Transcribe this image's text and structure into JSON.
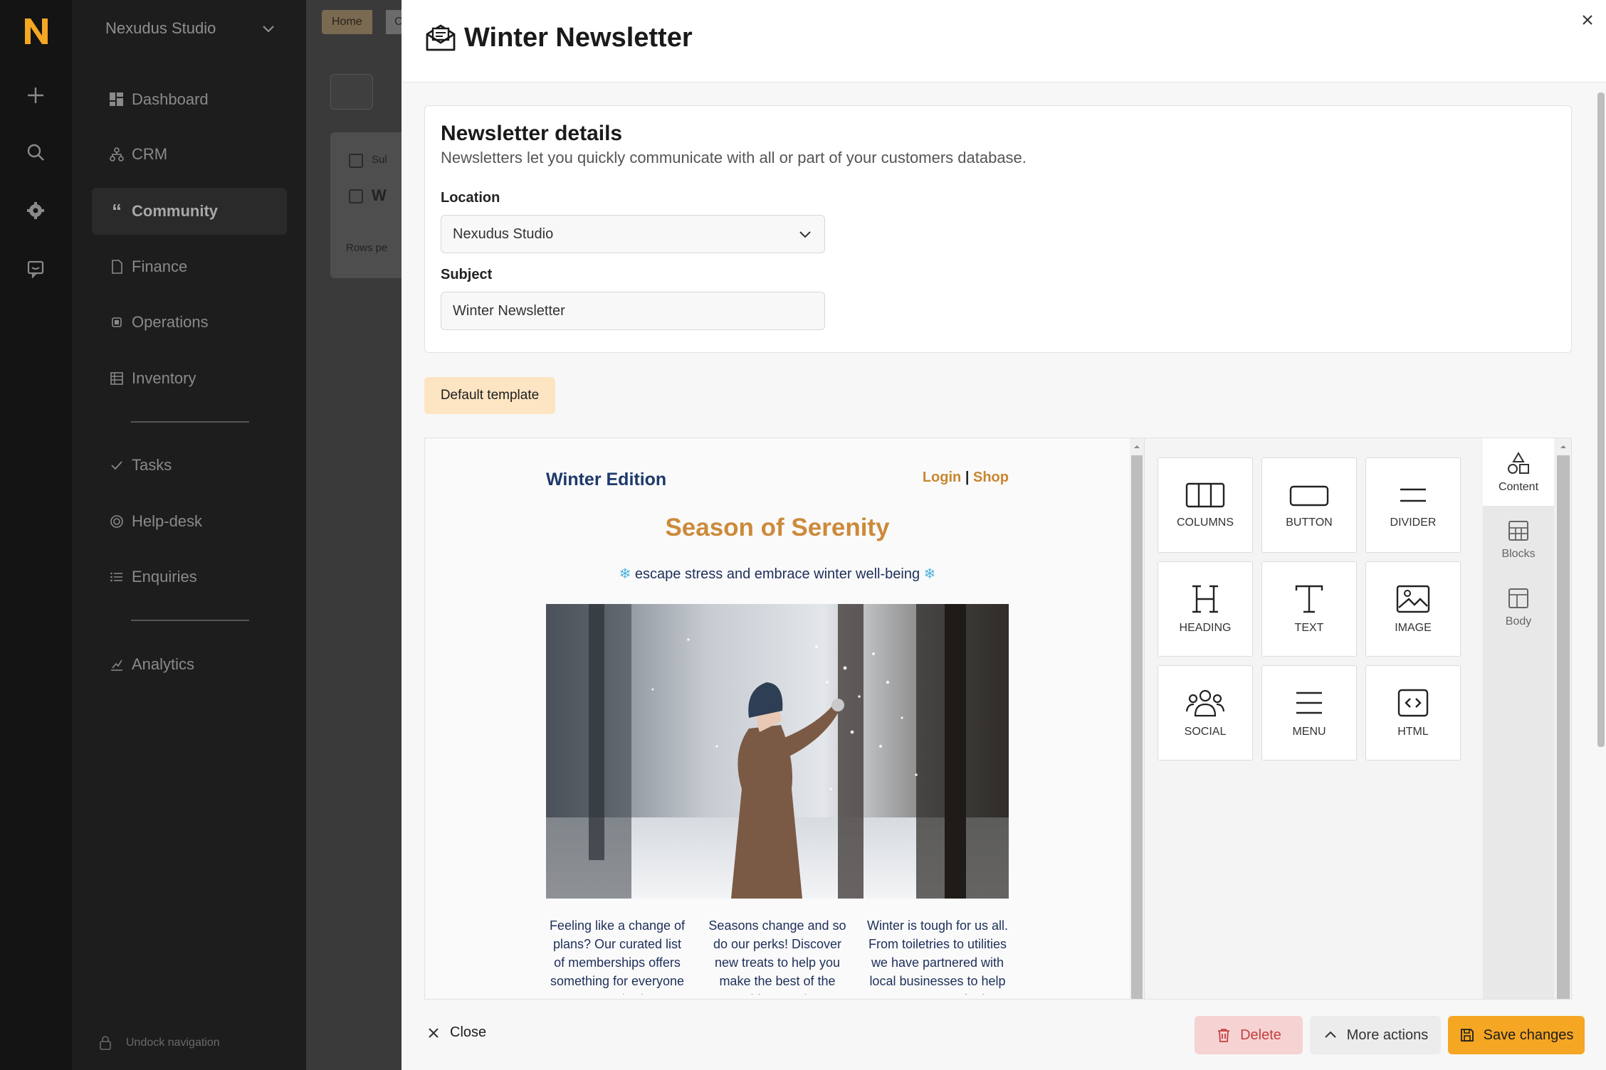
{
  "sidebar": {
    "workspace": "Nexudus Studio",
    "items": [
      {
        "label": "Dashboard"
      },
      {
        "label": "CRM"
      },
      {
        "label": "Community"
      },
      {
        "label": "Finance"
      },
      {
        "label": "Operations"
      },
      {
        "label": "Inventory"
      },
      {
        "label": "Tasks"
      },
      {
        "label": "Help-desk"
      },
      {
        "label": "Enquiries"
      },
      {
        "label": "Analytics"
      }
    ],
    "undock": "Undock navigation"
  },
  "background": {
    "breadcrumb_home": "Home",
    "breadcrumb_next": "C",
    "col_header": "Sul",
    "row_text": "W",
    "rows_per": "Rows pe"
  },
  "modal": {
    "title": "Winter Newsletter",
    "details": {
      "heading": "Newsletter details",
      "description": "Newsletters let you quickly communicate with all or part of your customers database.",
      "location_label": "Location",
      "location_value": "Nexudus Studio",
      "subject_label": "Subject",
      "subject_value": "Winter Newsletter"
    },
    "template_button": "Default template"
  },
  "email": {
    "brand": "Winter Edition",
    "link_login": "Login",
    "link_sep": "|",
    "link_shop": "Shop",
    "headline": "Season of Serenity",
    "subline_flake_left": "❄",
    "subline": "escape stress and embrace winter well-being",
    "subline_flake_right": "❄",
    "columns": [
      "Feeling like a change of plans? Our curated list of memberships offers something for everyone at every budget",
      "Seasons change and so do our perks! Discover new treats to help you make the best of the colder months",
      "Winter is tough for us all. From toiletries to utilities we have partnered with local businesses to help your money go further"
    ]
  },
  "tools": {
    "tiles": [
      {
        "label": "COLUMNS",
        "icon": "columns-icon"
      },
      {
        "label": "BUTTON",
        "icon": "button-icon"
      },
      {
        "label": "DIVIDER",
        "icon": "divider-icon"
      },
      {
        "label": "HEADING",
        "icon": "heading-icon"
      },
      {
        "label": "TEXT",
        "icon": "text-icon"
      },
      {
        "label": "IMAGE",
        "icon": "image-icon"
      },
      {
        "label": "SOCIAL",
        "icon": "social-icon"
      },
      {
        "label": "MENU",
        "icon": "menu-icon"
      },
      {
        "label": "HTML",
        "icon": "html-icon"
      }
    ],
    "tabs": [
      {
        "label": "Content",
        "icon": "shapes-icon"
      },
      {
        "label": "Blocks",
        "icon": "blocks-icon"
      },
      {
        "label": "Body",
        "icon": "body-icon"
      }
    ]
  },
  "footer": {
    "close": "Close",
    "delete": "Delete",
    "more": "More actions",
    "save": "Save changes"
  },
  "colors": {
    "accent": "#f5a623",
    "brand_navy": "#1e3a6b",
    "headline_orange": "#cc8a3a",
    "delete_bg": "#f6d3d3"
  }
}
